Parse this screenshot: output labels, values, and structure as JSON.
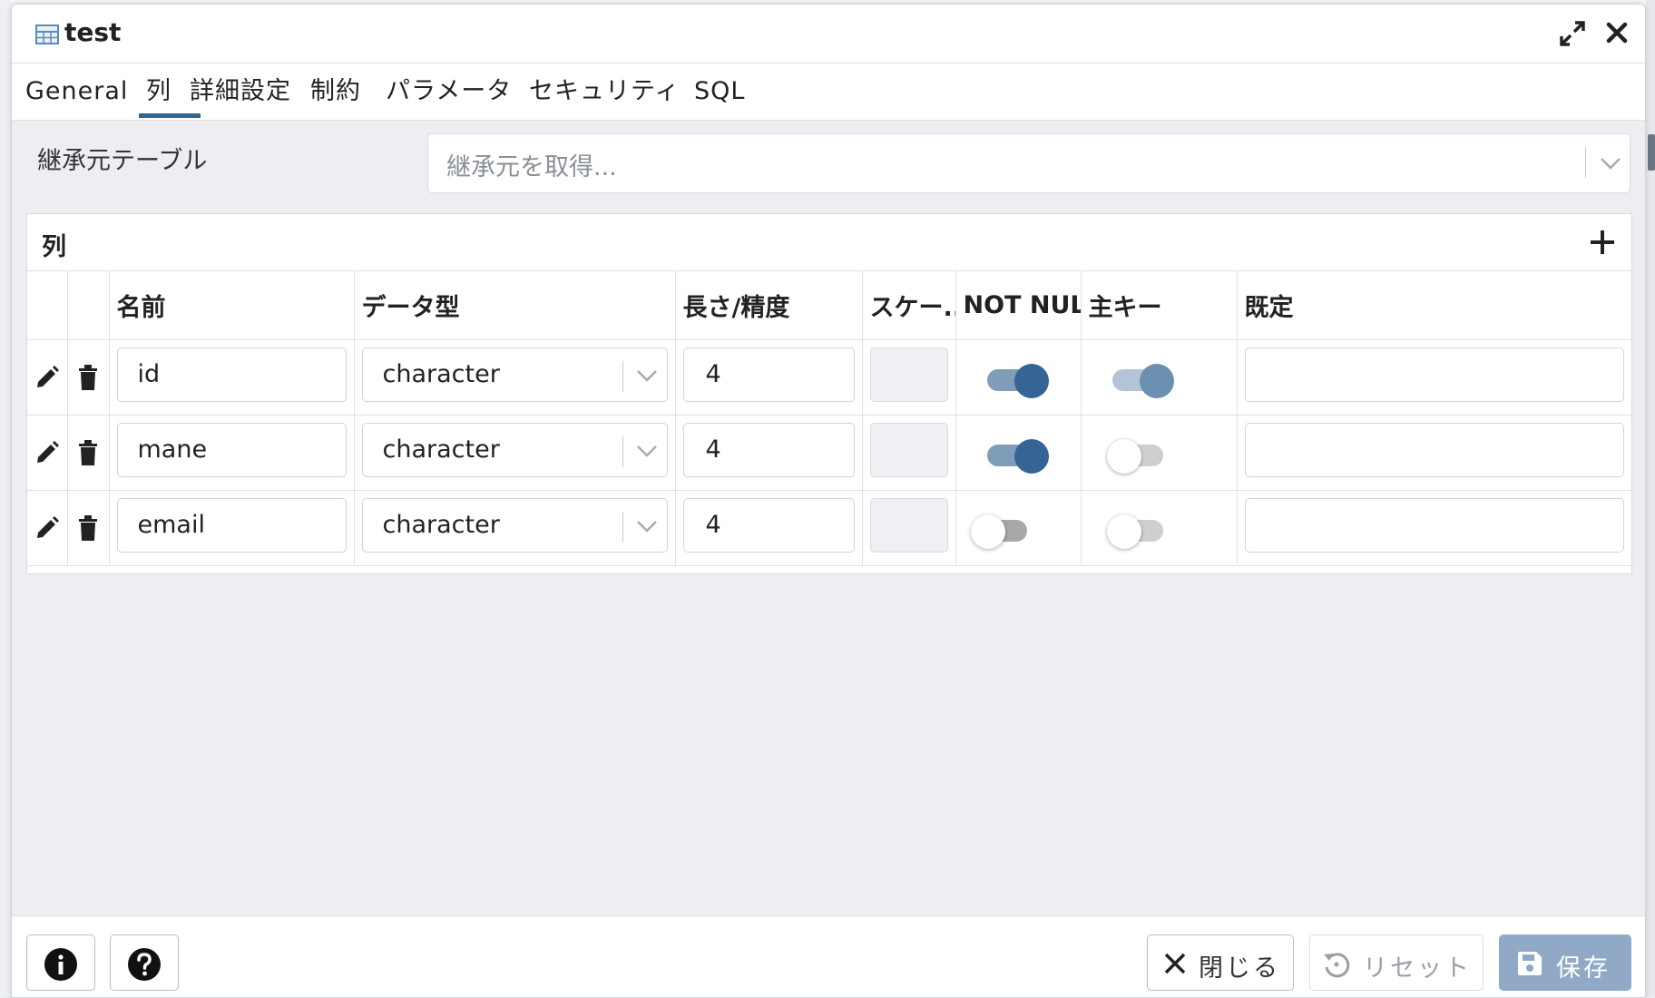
{
  "window": {
    "title": "test"
  },
  "tabs": [
    {
      "label": "General"
    },
    {
      "label": "列"
    },
    {
      "label": "詳細設定"
    },
    {
      "label": "制約"
    },
    {
      "label": "パラメータ"
    },
    {
      "label": "セキュリティ"
    },
    {
      "label": "SQL"
    }
  ],
  "active_tab": "列",
  "inherit": {
    "label": "継承元テーブル",
    "placeholder": "継承元を取得..."
  },
  "columns_panel": {
    "title": "列",
    "headers": {
      "name": "名前",
      "datatype": "データ型",
      "length": "長さ/精度",
      "scale": "スケー...",
      "notnull": "NOT NULL",
      "pk": "主キー",
      "default": "既定"
    },
    "rows": [
      {
        "name": "id",
        "datatype": "character",
        "length": "4",
        "scale": "",
        "not_null": true,
        "primary_key": true,
        "default": ""
      },
      {
        "name": "mane",
        "datatype": "character",
        "length": "4",
        "scale": "",
        "not_null": true,
        "primary_key": false,
        "default": ""
      },
      {
        "name": "email",
        "datatype": "character",
        "length": "4",
        "scale": "",
        "not_null": false,
        "primary_key": false,
        "default": ""
      }
    ]
  },
  "footer": {
    "close_label": "閉じる",
    "reset_label": "リセット",
    "save_label": "保存"
  },
  "colors": {
    "accent": "#326690",
    "toggle_on": "#356495",
    "save_button": "#8fa9c6"
  }
}
